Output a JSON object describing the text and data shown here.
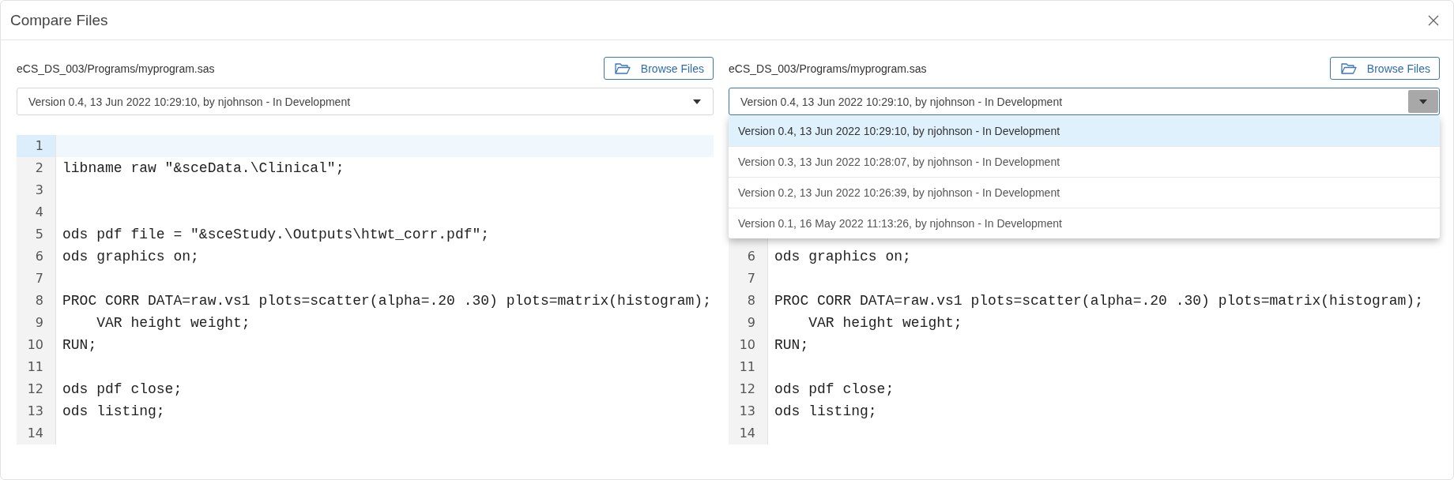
{
  "dialog": {
    "title": "Compare Files"
  },
  "panes": [
    {
      "file_path": "eCS_DS_003/Programs/myprogram.sas",
      "browse_button": "Browse Files",
      "version_select": {
        "value": "Version 0.4, 13 Jun 2022 10:29:10, by njohnson - In Development",
        "expanded": false
      },
      "code": {
        "lines": [
          {
            "number": "1",
            "active": true
          },
          {
            "number": "2",
            "text": "libname raw \"&sceData.\\Clinical\";",
            "active": false
          },
          {
            "number": "3",
            "active": false
          },
          {
            "number": "4",
            "active": false
          },
          {
            "number": "5",
            "text": "ods pdf file = \"&sceStudy.\\Outputs\\htwt_corr.pdf\";",
            "active": false
          },
          {
            "number": "6",
            "text": "ods graphics on;",
            "active": false
          },
          {
            "number": "7",
            "active": false
          },
          {
            "number": "8",
            "text": "PROC CORR DATA=raw.vs1 plots=scatter(alpha=.20 .30) plots=matrix(histogram);",
            "active": false
          },
          {
            "number": "9",
            "text": "    VAR height weight;",
            "active": false
          },
          {
            "number": "10",
            "text": "RUN;",
            "active": false
          },
          {
            "number": "11",
            "active": false
          },
          {
            "number": "12",
            "text": "ods pdf close;",
            "active": false
          },
          {
            "number": "13",
            "text": "ods listing;",
            "active": false
          },
          {
            "number": "14",
            "active": false
          }
        ]
      }
    },
    {
      "file_path": "eCS_DS_003/Programs/myprogram.sas",
      "browse_button": "Browse Files",
      "version_select": {
        "value": "Version 0.4, 13 Jun 2022 10:29:10, by njohnson - In Development",
        "expanded": true,
        "options": [
          {
            "label": "Version 0.4, 13 Jun 2022 10:29:10, by njohnson - In Development",
            "selected": true
          },
          {
            "label": "Version 0.3, 13 Jun 2022 10:28:07, by njohnson - In Development",
            "selected": false
          },
          {
            "label": "Version 0.2, 13 Jun 2022 10:26:39, by njohnson - In Development",
            "selected": false
          },
          {
            "label": "Version 0.1, 16 May 2022 11:13:26, by njohnson - In Development",
            "selected": false
          }
        ]
      },
      "code": {
        "lines": [
          {
            "number": "6",
            "text": "ods graphics on;",
            "active": false
          },
          {
            "number": "7",
            "active": false
          },
          {
            "number": "8",
            "text": "PROC CORR DATA=raw.vs1 plots=scatter(alpha=.20 .30) plots=matrix(histogram);",
            "active": false
          },
          {
            "number": "9",
            "text": "    VAR height weight;",
            "active": false
          },
          {
            "number": "10",
            "text": "RUN;",
            "active": false
          },
          {
            "number": "11",
            "active": false
          },
          {
            "number": "12",
            "text": "ods pdf close;",
            "active": false
          },
          {
            "number": "13",
            "text": "ods listing;",
            "active": false
          },
          {
            "number": "14",
            "active": false
          }
        ]
      }
    }
  ]
}
